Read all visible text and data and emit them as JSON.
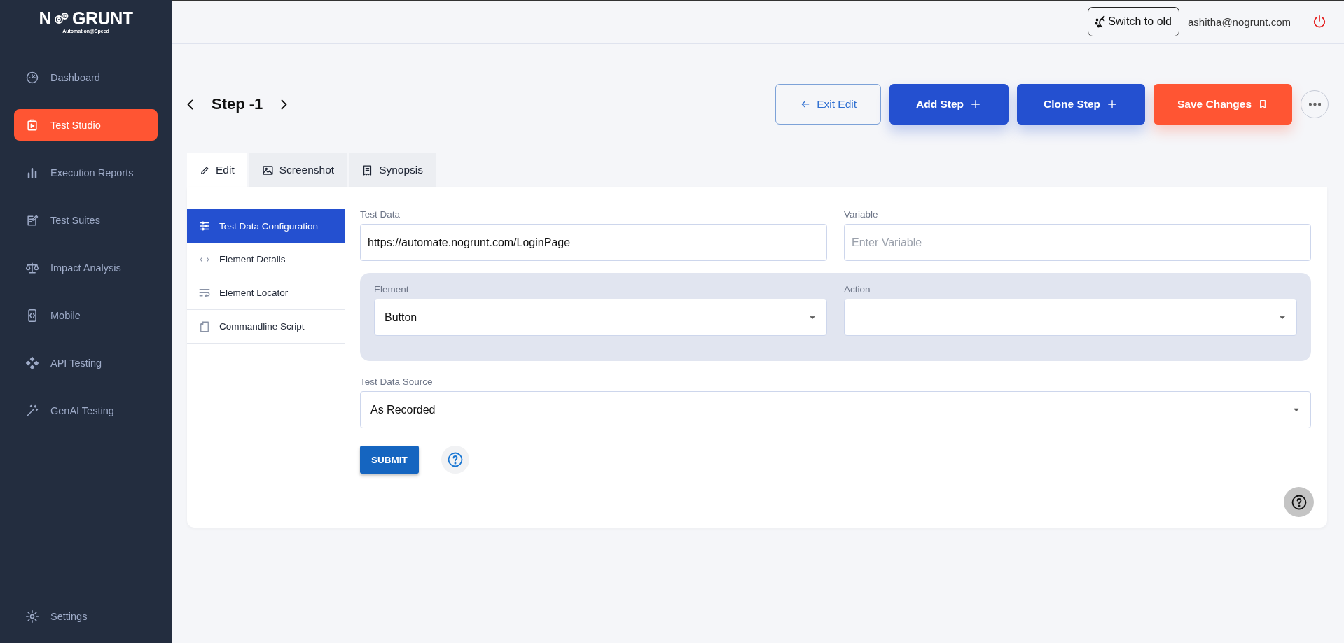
{
  "logo": {
    "prefix": "N",
    "suffix": "GRUNT",
    "tagline": "Automation@Speed"
  },
  "sidebar": {
    "items": [
      {
        "label": "Dashboard",
        "selected": false
      },
      {
        "label": "Test Studio",
        "selected": true
      },
      {
        "label": "Execution Reports",
        "selected": false
      },
      {
        "label": "Test Suites",
        "selected": false
      },
      {
        "label": "Impact Analysis",
        "selected": false
      },
      {
        "label": "Mobile",
        "selected": false
      },
      {
        "label": "API Testing",
        "selected": false
      },
      {
        "label": "GenAI Testing",
        "selected": false
      }
    ],
    "footer_item": {
      "label": "Settings"
    }
  },
  "header": {
    "switch_button": "Switch to old",
    "user_email": "ashitha@nogrunt.com"
  },
  "step": {
    "title": "Step -1",
    "buttons": [
      {
        "label": "Exit Edit",
        "kind": "outline"
      },
      {
        "label": "Add Step",
        "kind": "primary"
      },
      {
        "label": "Clone Step",
        "kind": "primary"
      },
      {
        "label": "Save Changes",
        "kind": "accent"
      }
    ]
  },
  "tabs": [
    {
      "label": "Edit",
      "selected": true
    },
    {
      "label": "Screenshot",
      "selected": false
    },
    {
      "label": "Synopsis",
      "selected": false
    }
  ],
  "config_menu": [
    {
      "label": "Test Data Configuration",
      "selected": true
    },
    {
      "label": "Element Details",
      "selected": false
    },
    {
      "label": "Element Locator",
      "selected": false
    },
    {
      "label": "Commandline Script",
      "selected": false
    }
  ],
  "form": {
    "test_data": {
      "label": "Test Data",
      "value": "https://automate.nogrunt.com/LoginPage"
    },
    "variable": {
      "label": "Variable",
      "placeholder": "Enter Variable"
    },
    "element": {
      "label": "Element",
      "value": "Button"
    },
    "action": {
      "label": "Action"
    },
    "test_data_source": {
      "label": "Test Data Source",
      "value": "As Recorded"
    },
    "submit": "SUBMIT"
  }
}
